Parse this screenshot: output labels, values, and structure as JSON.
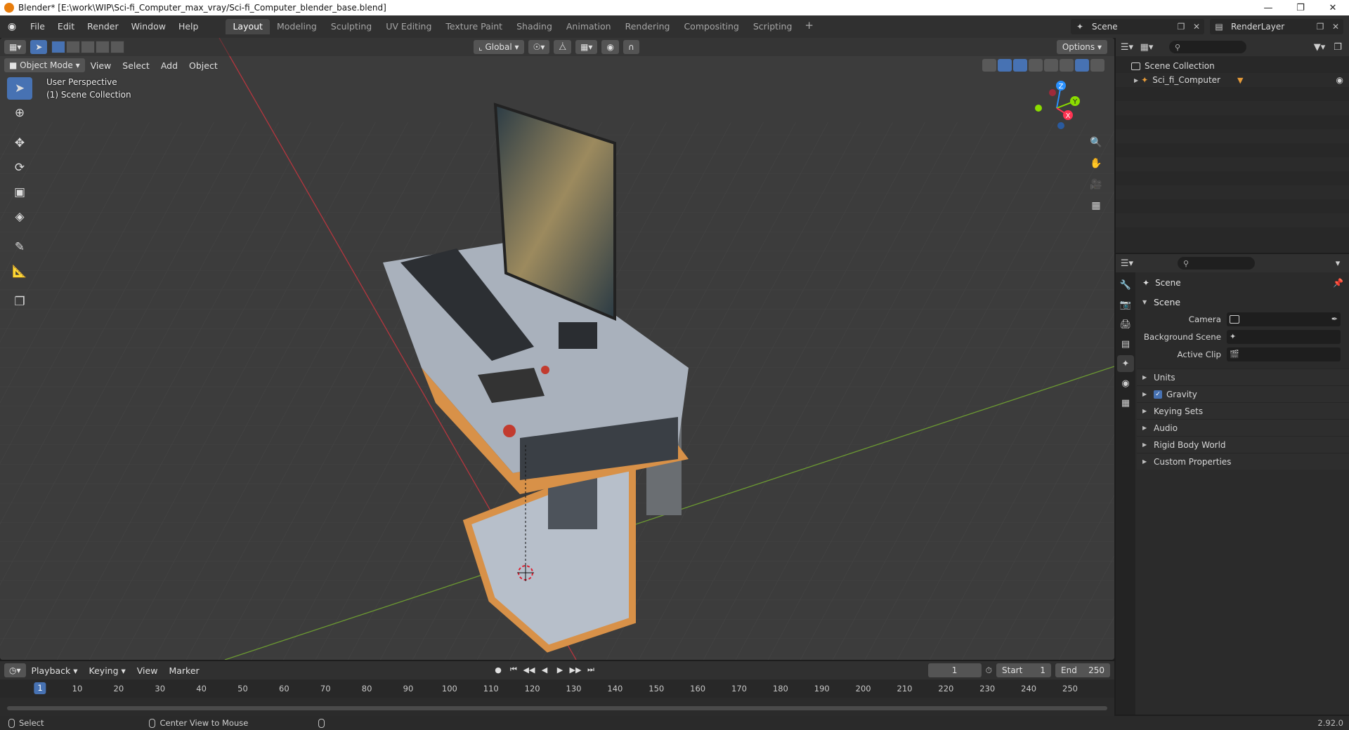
{
  "window": {
    "title": "Blender* [E:\\work\\WIP\\Sci-fi_Computer_max_vray/Sci-fi_Computer_blender_base.blend]",
    "controls": [
      "minimize",
      "restore",
      "close"
    ]
  },
  "menu": [
    "File",
    "Edit",
    "Render",
    "Window",
    "Help"
  ],
  "workspaces": {
    "tabs": [
      "Layout",
      "Modeling",
      "Sculpting",
      "UV Editing",
      "Texture Paint",
      "Shading",
      "Animation",
      "Rendering",
      "Compositing",
      "Scripting"
    ],
    "active": "Layout",
    "add": "+"
  },
  "topbar_right": {
    "scene": "Scene",
    "view_layer": "RenderLayer"
  },
  "viewport": {
    "mode": "Object Mode",
    "menus": [
      "View",
      "Select",
      "Add",
      "Object"
    ],
    "orientation": "Global",
    "options": "Options",
    "perspective": "User Perspective",
    "collection": "(1) Scene Collection",
    "gizmo_axes": {
      "x": "X",
      "y": "Y",
      "z": "Z",
      "x_color": "#ff3352",
      "y_color": "#8bdc00",
      "z_color": "#2890ff"
    },
    "tools": [
      "select-box-icon",
      "cursor-icon",
      "move-icon",
      "rotate-icon",
      "scale-icon",
      "transform-icon",
      "annotate-icon",
      "measure-icon",
      "add-cube-icon"
    ],
    "nav": [
      "zoom-icon",
      "pan-hand-icon",
      "camera-view-icon",
      "ortho-grid-icon"
    ]
  },
  "timeline": {
    "menus": [
      "Playback",
      "Keying",
      "View",
      "Marker"
    ],
    "current_frame": "1",
    "start_label": "Start",
    "start": "1",
    "end_label": "End",
    "end": "250",
    "ruler": [
      "10",
      "20",
      "30",
      "40",
      "50",
      "60",
      "70",
      "80",
      "90",
      "100",
      "110",
      "120",
      "130",
      "140",
      "150",
      "160",
      "170",
      "180",
      "190",
      "200",
      "210",
      "220",
      "230",
      "240",
      "250"
    ],
    "playhead": "1"
  },
  "statusbar": {
    "left": "Select",
    "middle": "Center View to Mouse",
    "version": "2.92.0"
  },
  "outliner": {
    "root": "Scene Collection",
    "items": [
      {
        "name": "Sci_fi_Computer"
      }
    ]
  },
  "properties": {
    "context": "Scene",
    "section": "Scene",
    "fields": [
      {
        "label": "Camera",
        "value": ""
      },
      {
        "label": "Background Scene",
        "value": ""
      },
      {
        "label": "Active Clip",
        "value": ""
      }
    ],
    "subpanels": [
      "Units",
      "Gravity",
      "Keying Sets",
      "Audio",
      "Rigid Body World",
      "Custom Properties"
    ],
    "gravity_checked": true
  },
  "colors": {
    "accent": "#4772b3",
    "object_orange": "#e59a39",
    "viewport_bg": "#3c3c3c"
  }
}
